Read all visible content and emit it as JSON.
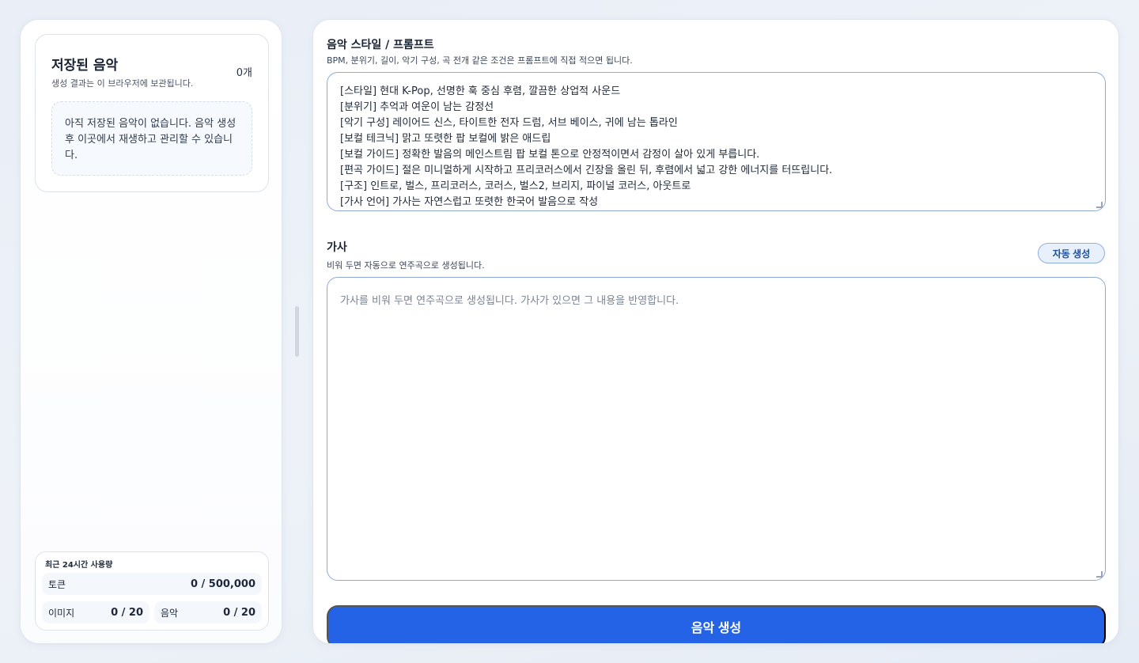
{
  "saved": {
    "title": "저장된 음악",
    "count": "0개",
    "subtitle": "생성 결과는 이 브라우저에 보관됩니다.",
    "empty_message": "아직 저장된 음악이 없습니다. 음악 생성 후 이곳에서 재생하고 관리할 수 있습니다."
  },
  "usage": {
    "title": "최근 24시간 사용량",
    "tokens_label": "토큰",
    "tokens_value": "0 / 500,000",
    "image_label": "이미지",
    "image_value": "0 / 20",
    "music_label": "음악",
    "music_value": "0 / 20"
  },
  "prompt": {
    "label": "음악 스타일 / 프롬프트",
    "help": "BPM, 분위기, 길이, 악기 구성, 곡 전개 같은 조건은 프롬프트에 직접 적으면 됩니다.",
    "lines": [
      "[스타일] 현대 K-Pop, 선명한 훅 중심 후렴, 깔끔한 상업적 사운드",
      "[분위기] 추억과 여운이 남는 감정선",
      "[악기 구성] 레이어드 신스, 타이트한 전자 드럼, 서브 베이스, 귀에 남는 톱라인",
      "[보컬 테크닉] 맑고 또렷한 팝 보컬에 밝은 애드립",
      "[보컬 가이드] 정확한 발음의 메인스트림 팝 보컬 톤으로 안정적이면서 감정이 살아 있게 부릅니다.",
      "[편곡 가이드] 절은 미니멀하게 시작하고 프리코러스에서 긴장을 올린 뒤, 후렴에서 넓고 강한 에너지를 터뜨립니다.",
      "[구조] 인트로, 벌스, 프리코러스, 코러스, 벌스2, 브리지, 파이널 코러스, 아웃트로",
      "[가사 언어] 가사는 자연스럽고 또렷한 한국어 발음으로 작성"
    ]
  },
  "lyrics": {
    "label": "가사",
    "help": "비워 두면 자동으로 연주곡으로 생성됩니다.",
    "auto_button": "자동 생성",
    "placeholder": "가사를 비워 두면 연주곡으로 생성됩니다. 가사가 있으면 그 내용을 반영합니다."
  },
  "generate_button": "음악 생성"
}
